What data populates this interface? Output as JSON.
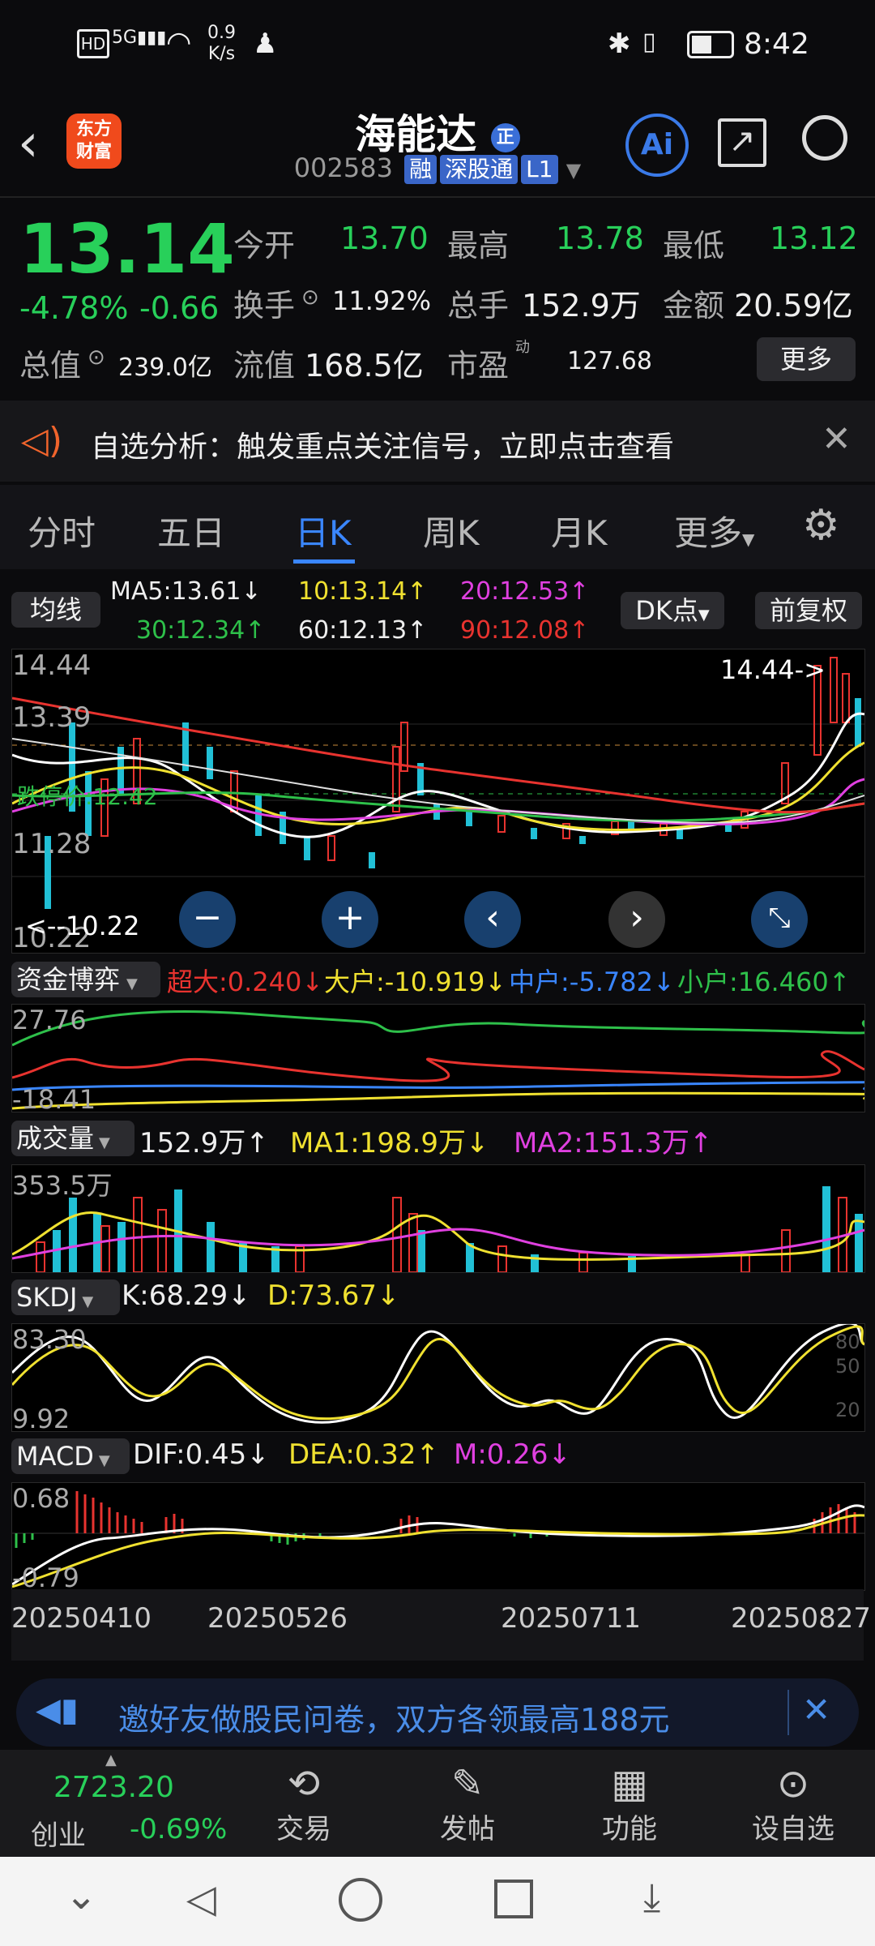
{
  "status_bar": {
    "network_speed_value": "0.9",
    "network_speed_unit": "K/s",
    "time": "8:42"
  },
  "header": {
    "logo_line1": "东方",
    "logo_line2": "财富",
    "stock_name": "海能达",
    "code": "002583",
    "badges": [
      "融",
      "深股通",
      "L1"
    ],
    "ai_label": "Ai"
  },
  "quote": {
    "price": "13.14",
    "change_pct": "-4.78%",
    "change_abs": "-0.66",
    "open_label": "今开",
    "open": "13.70",
    "high_label": "最高",
    "high": "13.78",
    "low_label": "最低",
    "low": "13.12",
    "turnover_label": "换手",
    "turnover": "11.92%",
    "volume_label": "总手",
    "volume": "152.9万",
    "amount_label": "金额",
    "amount": "20.59亿",
    "total_mv_label": "总值",
    "total_mv": "239.0亿",
    "float_mv_label": "流值",
    "float_mv": "168.5亿",
    "pe_label": "市盈",
    "pe_sup": "动",
    "pe": "127.68",
    "more_label": "更多"
  },
  "notice": {
    "text": "自选分析：触发重点关注信号，立即点击查看"
  },
  "tabs": [
    "分时",
    "五日",
    "日K",
    "周K",
    "月K",
    "更多"
  ],
  "active_tab": "日K",
  "ma_legend": {
    "selector": "均线",
    "ma5": "MA5:13.61↓",
    "ma10": "10:13.14↑",
    "ma20": "20:12.53↑",
    "ma30": "30:12.34↑",
    "ma60": "60:12.13↑",
    "ma90": "90:12.08↑",
    "dk_label": "DK点",
    "adjust_label": "前复权"
  },
  "kline": {
    "y_top": "14.44",
    "y_second": "13.39",
    "y_mid": "11.28",
    "y_bottom": "10.22",
    "limit_down_label": "跌停价:12.42",
    "max_marker": "14.44->",
    "min_marker": "<--10.22"
  },
  "fund_flow": {
    "selector": "资金博弈",
    "super": "超大:0.240↓",
    "big": "大户:-10.919↓",
    "mid": "中户:-5.782↓",
    "small": "小户:16.460↑",
    "y_top": "27.76",
    "y_bottom": "-18.41"
  },
  "volume_panel": {
    "selector": "成交量",
    "vol": "152.9万↑",
    "ma1": "MA1:198.9万↓",
    "ma2": "MA2:151.3万↑",
    "y_top": "353.5万"
  },
  "skdj": {
    "selector": "SKDJ",
    "k": "K:68.29↓",
    "d": "D:73.67↓",
    "y_top": "83.30",
    "y_bottom": "9.92",
    "ref80": "80",
    "ref50": "50",
    "ref20": "20"
  },
  "macd": {
    "selector": "MACD",
    "dif": "DIF:0.45↓",
    "dea": "DEA:0.32↑",
    "m": "M:0.26↓",
    "y_top": "0.68",
    "y_bottom": "-0.79"
  },
  "dates": [
    "20250410",
    "20250526",
    "20250711",
    "20250827"
  ],
  "banner": {
    "text": "邀好友做股民问卷，双方各领最高188元"
  },
  "bottom_nav": {
    "index_value": "2723.20",
    "index_name": "创业",
    "index_change": "-0.69%",
    "items": [
      "交易",
      "发帖",
      "功能",
      "设自选"
    ]
  },
  "colors": {
    "up": "#e8332f",
    "down": "#21c0d6",
    "ma5": "#ffffff",
    "ma10": "#f0e130",
    "ma20": "#e040e0",
    "ma30": "#2ec04a",
    "ma60": "#ffffff",
    "ma90": "#e8332f"
  }
}
